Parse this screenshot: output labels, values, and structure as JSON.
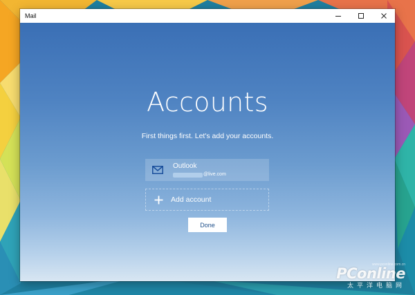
{
  "window": {
    "title": "Mail",
    "controls": {
      "minimize_icon": "minimize-icon",
      "maximize_icon": "maximize-icon",
      "close_icon": "close-icon"
    }
  },
  "main": {
    "heading": "Accounts",
    "subheading": "First things first. Let's add your accounts.",
    "account": {
      "name": "Outlook",
      "email_visible": "@live.com",
      "icon": "mail-icon"
    },
    "add_account": {
      "label": "Add account",
      "icon": "plus-icon"
    },
    "done_label": "Done"
  },
  "watermark": {
    "logo": "PConline",
    "chinese": "太平洋电脑网",
    "url": "www.pconline.com.cn"
  },
  "colors": {
    "accent": "#3a6fb5",
    "window_bg": "#ffffff",
    "button_text": "#1e4f8a"
  }
}
